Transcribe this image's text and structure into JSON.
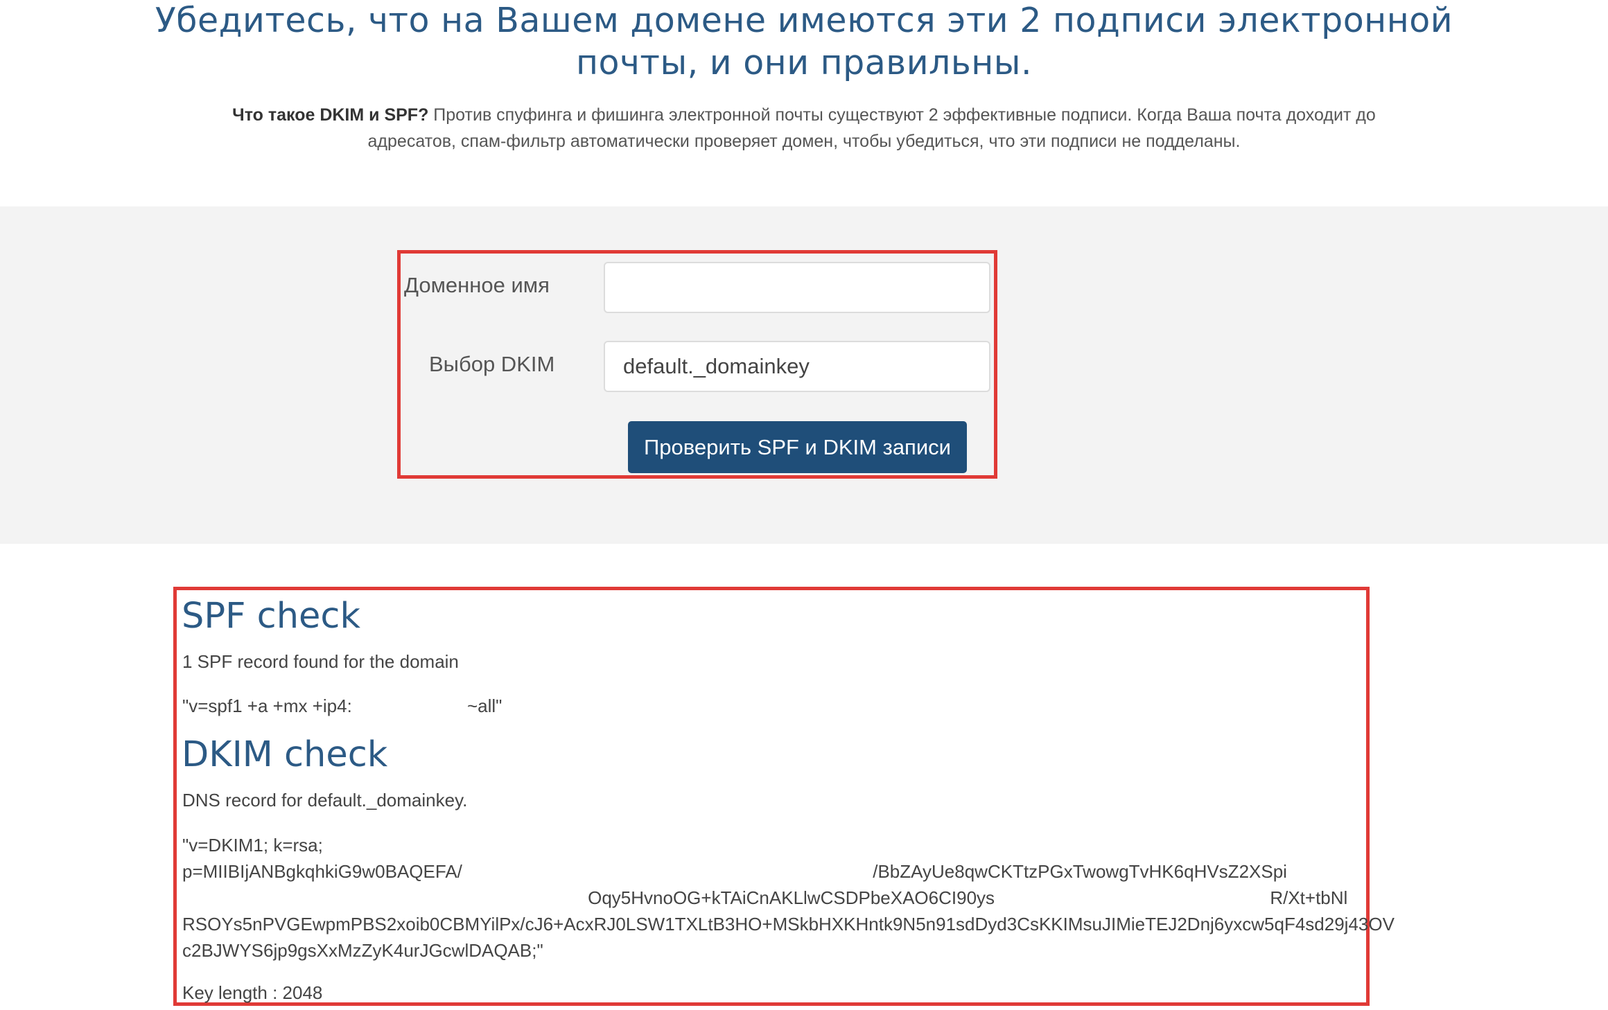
{
  "header": {
    "title_line1": "Убедитесь, что на Вашем домене имеются эти 2 подписи электронной",
    "title_line2": "почты, и они правильны.",
    "intro_bold": "Что такое DKIM и SPF?",
    "intro_line1": " Против спуфинга и фишинга электронной почты существуют 2 эффективные подписи. Когда Ваша почта доходит до",
    "intro_line2": "адресатов, спам-фильтр автоматически проверяет домен, чтобы убедиться, что эти подписи не подделаны."
  },
  "form": {
    "domain_label": "Доменное имя",
    "domain_value": "",
    "dkim_label": "Выбор DKIM",
    "dkim_value": "default._domainkey",
    "submit_label": "Проверить SPF и DKIM записи"
  },
  "results": {
    "spf_heading": "SPF check",
    "spf_found": "1 SPF record found for the domain",
    "spf_record": "\"v=spf1 +a +mx +ip4:                       ~all\"",
    "dkim_heading": "DKIM check",
    "dkim_dns": "DNS record for default._domainkey.",
    "dkim_record": "\"v=DKIM1; k=rsa;\np=MIIBIjANBgkqhkiG9w0BAQEFA/                                                                                  /BbZAyUe8qwCKTtzPGxTwowgTvHK6qHVsZ2XSpi\n                                                                                 Oqy5HvnoOG+kTAiCnAKLlwCSDPbeXAO6CI90ys                                                       R/Xt+tbNl\nRSOYs5nPVGEwpmPBS2xoib0CBMYilPx/cJ6+AcxRJ0LSW1TXLtB3HO+MSkbHXKHntk9N5n91sdDyd3CsKKIMsuJIMieTEJ2Dnj6yxcw5qF4sd29j43OV\nc2BJWYS6jp9gsXxMzZyK4urJGcwlDAQAB;\"",
    "key_length": "Key length : 2048"
  }
}
